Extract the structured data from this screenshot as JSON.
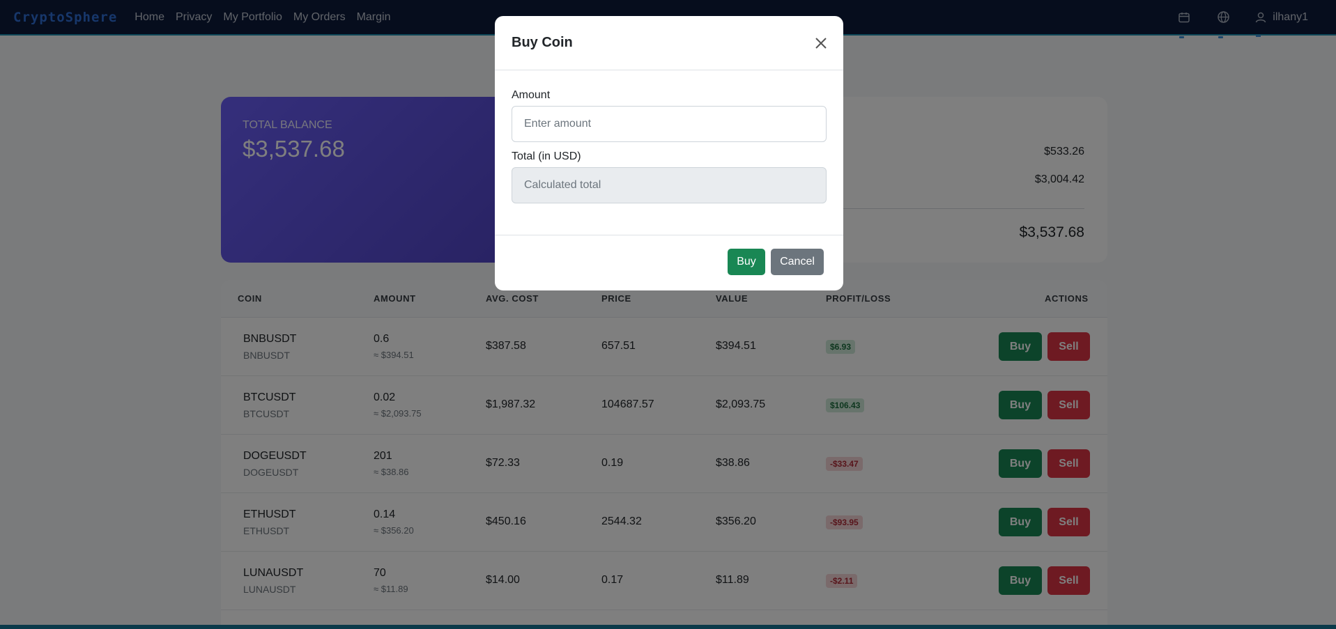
{
  "nav": {
    "brand": "CryptoSphere",
    "links": [
      "Home",
      "Privacy",
      "My Portfolio",
      "My Orders",
      "Margin"
    ],
    "icons": [
      "calendar-icon",
      "globe-icon",
      "user-icon"
    ],
    "username": "ilhany1"
  },
  "balance": {
    "label": "TOTAL BALANCE",
    "value": "$3,537.68"
  },
  "summary": {
    "row1": "$533.26",
    "row2": "$3,004.42",
    "total": "$3,537.68"
  },
  "table": {
    "headers": [
      "COIN",
      "AMOUNT",
      "AVG. COST",
      "PRICE",
      "VALUE",
      "PROFIT/LOSS",
      "ACTIONS"
    ],
    "buy_label": "Buy",
    "sell_label": "Sell",
    "rows": [
      {
        "symbol": "BNBUSDT",
        "sub": "BNBUSDT",
        "amount": "0.6",
        "amount_usd": "≈ $394.51",
        "avg": "$387.58",
        "price": "657.51",
        "value": "$394.51",
        "pl": "$6.93",
        "pl_positive": true
      },
      {
        "symbol": "BTCUSDT",
        "sub": "BTCUSDT",
        "amount": "0.02",
        "amount_usd": "≈ $2,093.75",
        "avg": "$1,987.32",
        "price": "104687.57",
        "value": "$2,093.75",
        "pl": "$106.43",
        "pl_positive": true
      },
      {
        "symbol": "DOGEUSDT",
        "sub": "DOGEUSDT",
        "amount": "201",
        "amount_usd": "≈ $38.86",
        "avg": "$72.33",
        "price": "0.19",
        "value": "$38.86",
        "pl": "-$33.47",
        "pl_positive": false
      },
      {
        "symbol": "ETHUSDT",
        "sub": "ETHUSDT",
        "amount": "0.14",
        "amount_usd": "≈ $356.20",
        "avg": "$450.16",
        "price": "2544.32",
        "value": "$356.20",
        "pl": "-$93.95",
        "pl_positive": false
      },
      {
        "symbol": "LUNAUSDT",
        "sub": "LUNAUSDT",
        "amount": "70",
        "amount_usd": "≈ $11.89",
        "avg": "$14.00",
        "price": "0.17",
        "value": "$11.89",
        "pl": "-$2.11",
        "pl_positive": false
      }
    ]
  },
  "modal": {
    "title": "Buy Coin",
    "amount_label": "Amount",
    "amount_placeholder": "Enter amount",
    "total_label": "Total (in USD)",
    "total_placeholder": "Calculated total",
    "buy_label": "Buy",
    "cancel_label": "Cancel"
  },
  "colors": {
    "navbar": "#0c1a3a",
    "brand": "#2f6fd6",
    "balance_gradient_start": "#6a5ef7",
    "buy_green": "#198754",
    "sell_red": "#dc3545",
    "cancel_gray": "#6c757d"
  }
}
